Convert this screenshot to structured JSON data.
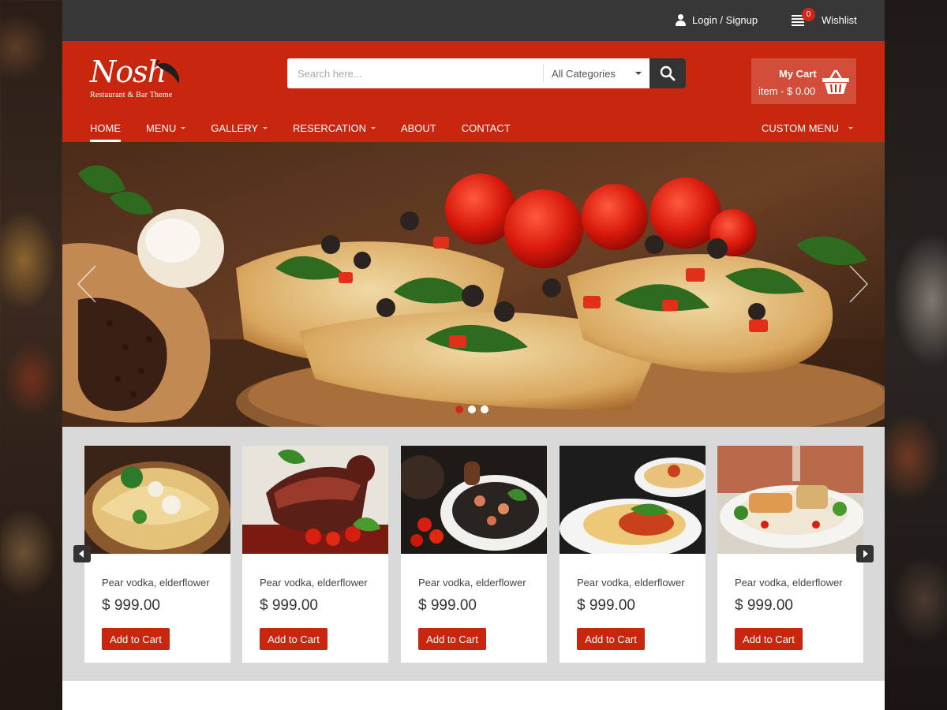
{
  "topbar": {
    "login_label": "Login / Signup",
    "wishlist_label": "Wishlist",
    "wishlist_count": "0"
  },
  "header": {
    "logo_text": "Nosh",
    "logo_subtitle": "Restaurant & Bar Theme",
    "search_placeholder": "Search here...",
    "category_selected": "All Categories",
    "cart_title": "My Cart",
    "cart_summary": "item - $ 0.00"
  },
  "nav": {
    "items": [
      {
        "label": "HOME"
      },
      {
        "label": "MENU"
      },
      {
        "label": "GALLERY"
      },
      {
        "label": "RESERCATION"
      },
      {
        "label": "ABOUT"
      },
      {
        "label": "CONTACT"
      }
    ],
    "custom_menu": "CUSTOM MENU"
  },
  "slider": {
    "slide_count": 3,
    "active_slide": 1
  },
  "products": [
    {
      "title": "Pear vodka, elderflower",
      "price": "$ 999.00",
      "button": "Add to Cart"
    },
    {
      "title": "Pear vodka, elderflower",
      "price": "$ 999.00",
      "button": "Add to Cart"
    },
    {
      "title": "Pear vodka, elderflower",
      "price": "$ 999.00",
      "button": "Add to Cart"
    },
    {
      "title": "Pear vodka, elderflower",
      "price": "$ 999.00",
      "button": "Add to Cart"
    },
    {
      "title": "Pear vodka, elderflower",
      "price": "$ 999.00",
      "button": "Add to Cart"
    }
  ],
  "colors": {
    "brand_red": "#c9260f",
    "topbar": "#373737",
    "products_bg": "#d9d9d9"
  }
}
